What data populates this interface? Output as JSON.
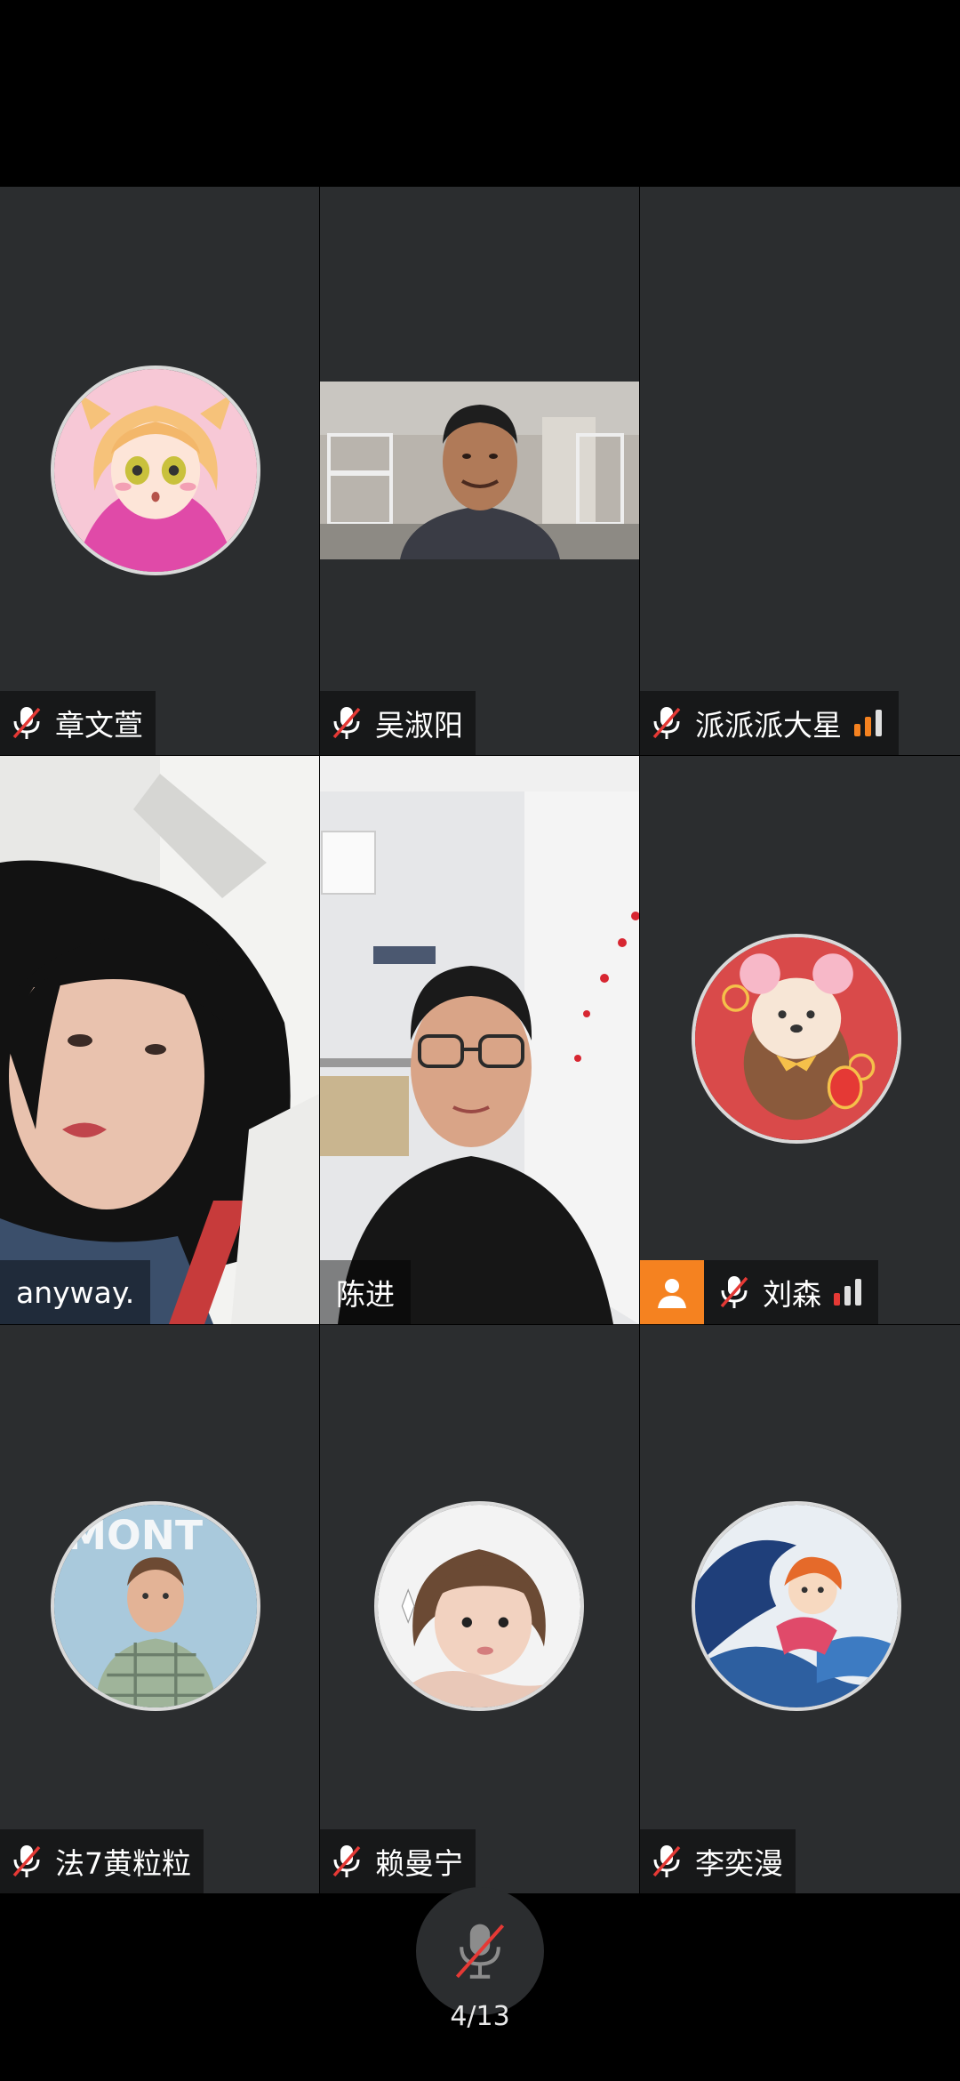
{
  "participants": [
    {
      "name": "章文萱",
      "muted": true,
      "avatar": "anime-fox-girl-avatar"
    },
    {
      "name": "吴淑阳",
      "muted": true,
      "video": "dorm-room-video"
    },
    {
      "name": "派派派大星",
      "muted": true,
      "signal": "medium",
      "avatar": "none"
    },
    {
      "name": "anyway.",
      "muted": false,
      "video": "selfie-video"
    },
    {
      "name": "陈进",
      "muted": false,
      "video": "office-video"
    },
    {
      "name": "刘森",
      "muted": true,
      "signal": "low",
      "host": true,
      "avatar": "bear-new-year-avatar"
    },
    {
      "name": "法7黄粒粒",
      "muted": true,
      "avatar": "boy-plaid-shirt-avatar"
    },
    {
      "name": "赖曼宁",
      "muted": true,
      "avatar": "little-girl-avatar"
    },
    {
      "name": "李奕漫",
      "muted": true,
      "avatar": "ponyo-wave-avatar"
    }
  ],
  "controls": {
    "mic_state": "muted",
    "page_indicator": "4/13"
  },
  "colors": {
    "tile_bg": "#2b2d2f",
    "accent_orange": "#f58220",
    "signal_orange": "#f58220",
    "signal_red": "#e53935",
    "mute_red": "#e53935"
  }
}
